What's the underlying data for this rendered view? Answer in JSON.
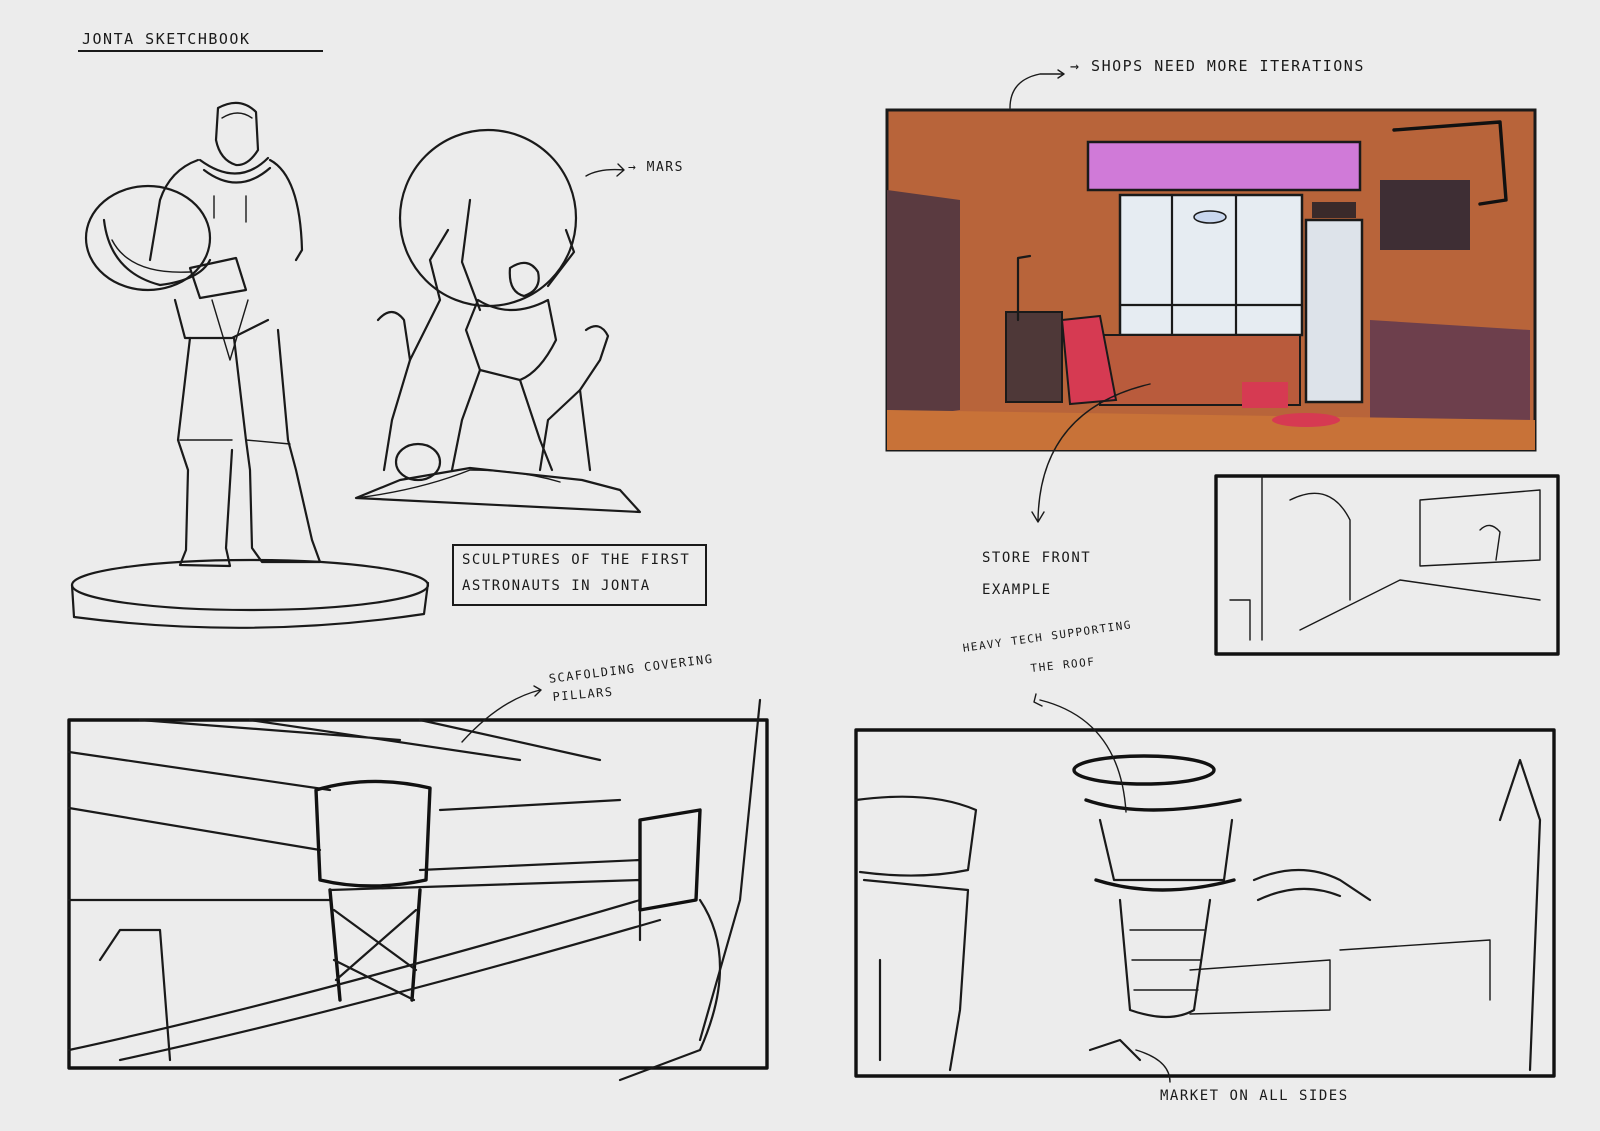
{
  "sheet": {
    "title": "JONTA SKETCHBOOK",
    "background": "#ececec",
    "ink_color": "#1a1a1a"
  },
  "annotations": {
    "mars": "→ MARS",
    "sculpture_caption_line1": "SCULPTURES OF THE FIRST",
    "sculpture_caption_line2": "ASTRONAUTS IN JONTA",
    "shops_note": "→ SHOPS NEED MORE ITERATIONS",
    "storefront_line1": "STORE FRONT",
    "storefront_line2": "EXAMPLE",
    "heavy_tech_line1": "HEAVY TECH SUPPORTING",
    "heavy_tech_line2": "THE ROOF",
    "scaffolding_line1": "SCAFOLDING COVERING",
    "scaffolding_line2": "PILLARS",
    "market": "MARKET ON ALL SIDES"
  },
  "panels": [
    {
      "id": "astronaut-statue",
      "icon": "astronaut-statue-sketch"
    },
    {
      "id": "mars-sculpture",
      "icon": "astronauts-holding-mars-sketch"
    },
    {
      "id": "storefront-color",
      "icon": "storefront-painting",
      "colors": {
        "wall": "#b8643a",
        "sign": "#d07ad8",
        "board": "#d63a52",
        "window": "#e6ecf2"
      }
    },
    {
      "id": "storefront-thumb",
      "icon": "market-stall-sketch"
    },
    {
      "id": "scaffolding-hall",
      "icon": "scaffolding-hall-sketch"
    },
    {
      "id": "tech-column-market",
      "icon": "tech-column-sketch"
    }
  ]
}
